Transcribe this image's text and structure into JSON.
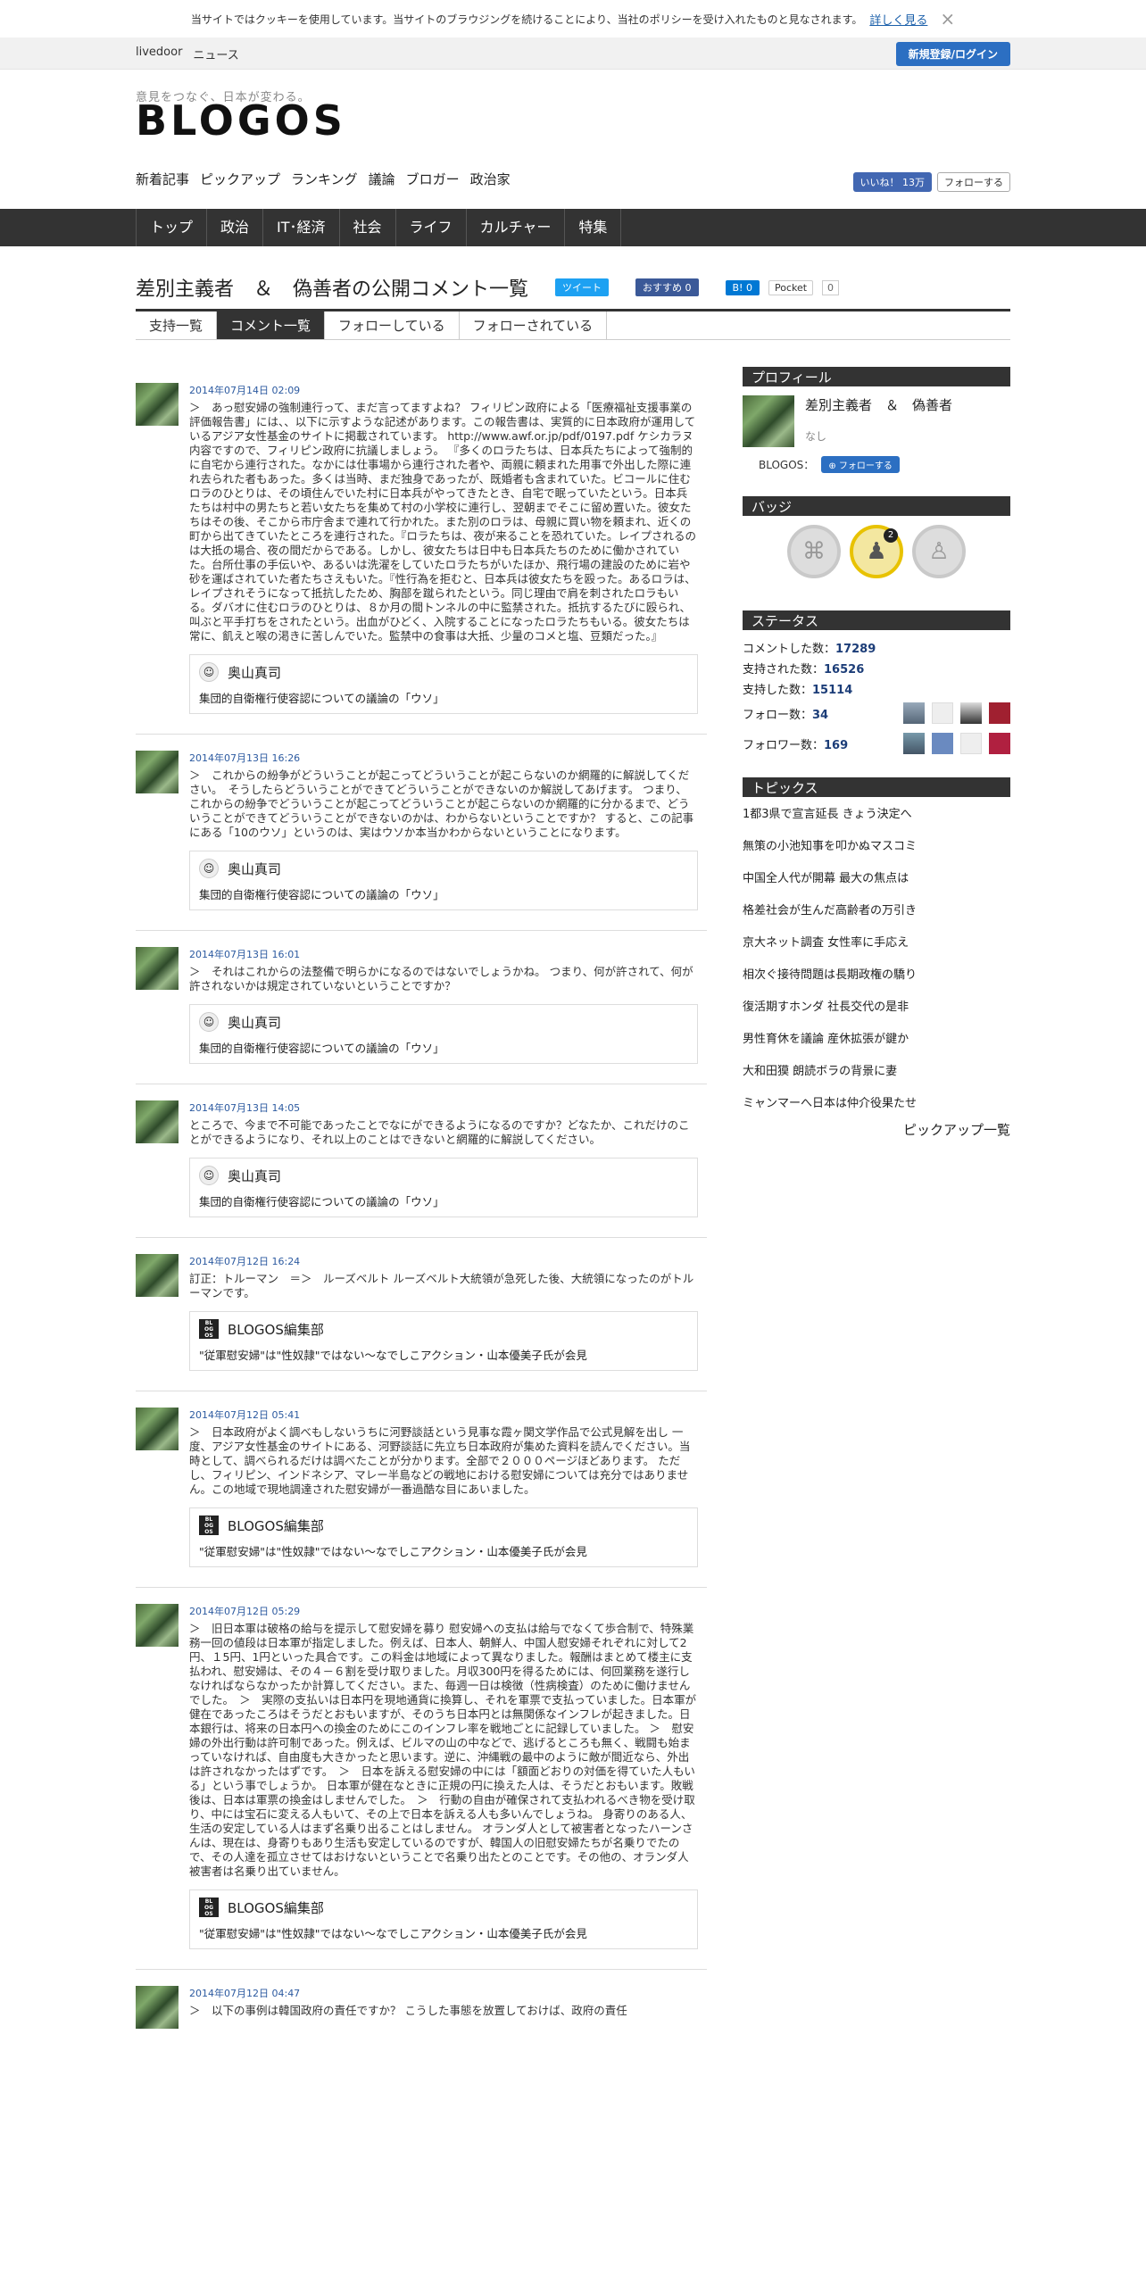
{
  "cookie": {
    "text": "当サイトではクッキーを使用しています。当サイトのブラウジングを続けることにより、当社のポリシーを受け入れたものと見なされます。",
    "link": "詳しく見る",
    "close": "×"
  },
  "topbar": {
    "livedoor": "livedoor",
    "news": "ニュース",
    "login": "新規登録/ログイン"
  },
  "header": {
    "tagline": "意見をつなぐ、日本が変わる。",
    "logo": "BLOGOS",
    "subnav": [
      "新着記事",
      "ピックアップ",
      "ランキング",
      "議論",
      "ブロガー",
      "政治家"
    ],
    "fb_like": "いいね！ 13万",
    "tw_follow": "フォローする"
  },
  "gnav": [
    "トップ",
    "政治",
    "IT･経済",
    "社会",
    "ライフ",
    "カルチャー",
    "特集"
  ],
  "page": {
    "title": "差別主義者　＆　偽善者の公開コメント一覧",
    "share": {
      "tweet": "ツイート",
      "fb": "おすすめ 0",
      "hatena": "B! 0",
      "pocket": "Pocket",
      "pocket_count": "0"
    },
    "tabs": [
      "支持一覧",
      "コメント一覧",
      "フォローしている",
      "フォローされている"
    ]
  },
  "comments": [
    {
      "date": "2014年07月14日 02:09",
      "text": "＞　あっ慰安婦の強制連行って、まだ言ってますよね？ フィリピン政府による「医療福祉支援事業の評価報告書」には、、以下に示すような記述があります。この報告書は、実質的に日本政府が運用しているアジア女性基金のサイトに掲載されています。 http://www.awf.or.jp/pdf/0197.pdf ケシカラヌ内容ですので、フィリピン政府に抗議しましょう。 『多くのロラたちは、日本兵たちによって強制的に自宅から連行された。なかには仕事場から連行された者や、両親に頼まれた用事で外出した際に連れ去られた者もあった。多くは当時、まだ独身であったが、既婚者も含まれていた。ビコールに住むロラのひとりは、その頃住んでいた村に日本兵がやってきたとき、自宅で眠っていたという。日本兵たちは村中の男たちと若い女たちを集めて村の小学校に連行し、翌朝までそこに留め置いた。彼女たちはその後、そこから市庁舎まで連れて行かれた。また別のロラは、母親に買い物を頼まれ、近くの町から出てきていたところを連行された。『ロラたちは、夜が来ることを恐れていた。レイプされるのは大抵の場合、夜の間だからである。しかし、彼女たちは日中も日本兵たちのために働かされていた。台所仕事の手伝いや、あるいは洗濯をしていたロラたちがいたほか、飛行場の建設のために岩や砂を運ばされていた者たちさえもいた。『性行為を拒むと、日本兵は彼女たちを殴った。あるロラは、レイプされそうになって抵抗したため、胸部を蹴られたという。同じ理由で肩を刺されたロラもいる。ダバオに住むロラのひとりは、８か月の間トンネルの中に監禁された。抵抗するたびに殴られ、叫ぶと平手打ちをされたという。出血がひどく、入院することになったロラたちもいる。彼女たちは常に、飢えと喉の渇きに苦しんでいた。監禁中の食事は大抵、少量のコメと塩、豆類だった。』",
      "ref_name": "奥山真司",
      "ref_type": "person",
      "ref_article": "集団的自衛権行使容認についての議論の「ウソ」"
    },
    {
      "date": "2014年07月13日 16:26",
      "text": "＞　これからの紛争がどういうことが起こってどういうことが起こらないのか網羅的に解説してください。　そうしたらどういうことができてどういうことができないのか解説してあげます。 つまり、これからの紛争でどういうことが起こってどういうことが起こらないのか網羅的に分かるまで、どういうことができてどういうことができないのかは、わからないということですか？ すると、この記事にある「10のウソ」というのは、実はウソか本当かわからないということになります。",
      "ref_name": "奥山真司",
      "ref_type": "person",
      "ref_article": "集団的自衛権行使容認についての議論の「ウソ」"
    },
    {
      "date": "2014年07月13日 16:01",
      "text": "＞　それはこれからの法整備で明らかになるのではないでしょうかね。 つまり、何が許されて、何が許されないかは規定されていないということですか？",
      "ref_name": "奥山真司",
      "ref_type": "person",
      "ref_article": "集団的自衛権行使容認についての議論の「ウソ」"
    },
    {
      "date": "2014年07月13日 14:05",
      "text": "ところで、今まで不可能であったことでなにができるようになるのですか？どなたか、これだけのことができるようになり、それ以上のことはできないと網羅的に解説してください。",
      "ref_name": "奥山真司",
      "ref_type": "person",
      "ref_article": "集団的自衛権行使容認についての議論の「ウソ」"
    },
    {
      "date": "2014年07月12日 16:24",
      "text": "訂正：トルーマン　＝＞　ルーズベルト ルーズベルト大統領が急死した後、大統領になったのがトルーマンです。",
      "ref_name": "BLOGOS編集部",
      "ref_type": "blogos",
      "ref_article": "\"従軍慰安婦\"は\"性奴隷\"ではない〜なでしこアクション・山本優美子氏が会見"
    },
    {
      "date": "2014年07月12日 05:41",
      "text": "＞　日本政府がよく調べもしないうちに河野談話という見事な霞ヶ関文学作品で公式見解を出し 一度、アジア女性基金のサイトにある、河野談話に先立ち日本政府が集めた資料を読んでください。当時として、調べられるだけは調べたことが分かります。全部で２０００ページほどあります。 ただし、フィリピン、インドネシア、マレー半島などの戦地における慰安婦については充分ではありません。この地域で現地調達された慰安婦が一番過酷な目にあいました。",
      "ref_name": "BLOGOS編集部",
      "ref_type": "blogos",
      "ref_article": "\"従軍慰安婦\"は\"性奴隷\"ではない〜なでしこアクション・山本優美子氏が会見"
    },
    {
      "date": "2014年07月12日 05:29",
      "text": "＞　旧日本軍は破格の給与を提示して慰安婦を募り 慰安婦への支払は給与でなくて歩合制で、特殊業務一回の値段は日本軍が指定しました。例えば、日本人、朝鮮人、中国人慰安婦それぞれに対して2円、１5円、1円といった具合です。この料金は地域によって異なりました。報酬はまとめて楼主に支払われ、慰安婦は、その４－６割を受け取りました。月収300円を得るためには、何回業務を遂行しなければならなかったか計算してください。また、毎週一日は検徴（性病検査）のために働けませんでした。　＞　実際の支払いは日本円を現地通貨に換算し、それを軍票で支払っていました。日本軍が健在であったころはそうだとおもいますが、そのうち日本円とは無関係なインフレが起きました。日本銀行は、将来の日本円への換金のためにこのインフレ率を戦地ごとに記録していました。 ＞　慰安婦の外出行動は許可制であった。例えば、ビルマの山の中などで、逃げるところも無く、戦闘も始まっていなければ、自由度も大きかったと思います。逆に、沖縄戦の最中のように敵が間近なら、外出は許されなかったはずです。　＞　日本を訴える慰安婦の中には「額面どおりの対価を得ていた人もいる」という事でしょうか。 日本軍が健在なときに正規の円に換えた人は、そうだとおもいます。敗戦後は、日本は軍票の換金はしませんでした。　＞　行動の自由が確保されて支払われるべき物を受け取り、中には宝石に変える人もいて、その上で日本を訴える人も多いんでしょうね。 身寄りのある人、生活の安定している人はまず名乗り出ることはしません。 オランダ人として被害者となったハーンさんは、現在は、身寄りもあり生活も安定しているのですが、韓国人の旧慰安婦たちが名乗りでたので、その人達を孤立させてはおけないということで名乗り出たとのことです。その他の、オランダ人被害者は名乗り出ていません。",
      "ref_name": "BLOGOS編集部",
      "ref_type": "blogos",
      "ref_article": "\"従軍慰安婦\"は\"性奴隷\"ではない〜なでしこアクション・山本優美子氏が会見"
    },
    {
      "date": "2014年07月12日 04:47",
      "text": "＞　以下の事例は韓国政府の責任ですか？ こうした事態を放置しておけば、政府の責任",
      "ref_name": "",
      "ref_type": "",
      "ref_article": ""
    }
  ],
  "sidebar": {
    "profile": {
      "heading": "プロフィール",
      "name": "差別主義者　＆　偽善者",
      "desc": "なし",
      "blogos_label": "BLOGOS：",
      "follow": "フォローする"
    },
    "badges": {
      "heading": "バッジ",
      "gold_count": "2"
    },
    "status": {
      "heading": "ステータス",
      "comments_label": "コメントした数：",
      "comments": "17289",
      "supported_label": "支持された数：",
      "supported": "16526",
      "supporting_label": "支持した数：",
      "supporting": "15114",
      "follows_label": "フォロー数：",
      "follows": "34",
      "followers_label": "フォロワー数：",
      "followers": "169"
    },
    "topics": {
      "heading": "トピックス",
      "items": [
        "1都3県で宣言延長 きょう決定へ",
        "無策の小池知事を叩かぬマスコミ",
        "中国全人代が開幕 最大の焦点は",
        "格差社会が生んだ高齢者の万引き",
        "京大ネット調査 女性率に手応え",
        "相次ぐ接待問題は長期政権の驕り",
        "復活期すホンダ 社長交代の是非",
        "男性育休を議論 産休拡張が鍵か",
        "大和田獏 朗読ボラの背景に妻",
        "ミャンマーへ日本は仲介役果たせ"
      ],
      "more": "ピックアップ一覧"
    }
  },
  "colors": {
    "accent": "#2c6fc2",
    "nav_bg": "#333333",
    "date": "#2c5aa0"
  }
}
